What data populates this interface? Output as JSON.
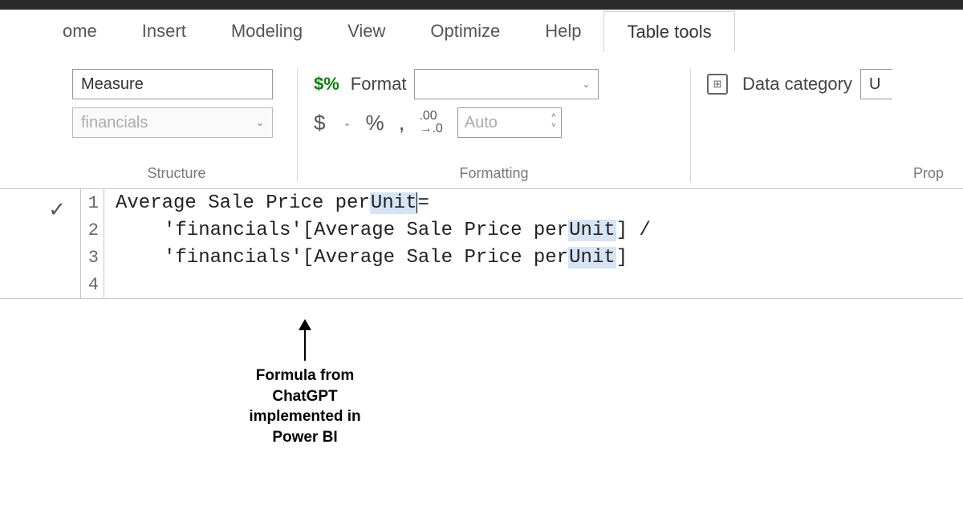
{
  "tabs": {
    "home": "ome",
    "insert": "Insert",
    "modeling": "Modeling",
    "view": "View",
    "optimize": "Optimize",
    "help": "Help",
    "table_tools": "Table tools"
  },
  "structure": {
    "name_value": "Measure",
    "table_value": "financials",
    "group_label": "Structure"
  },
  "formatting": {
    "format_label": "Format",
    "format_value": "",
    "decimals_placeholder": "Auto",
    "group_label": "Formatting"
  },
  "properties": {
    "category_label": "Data category",
    "category_value": "U",
    "group_label": "Prop"
  },
  "formula": {
    "lines": [
      {
        "n": "1",
        "prefix": "Average Sale Price per ",
        "hl": "Unit",
        "suffix": " ="
      },
      {
        "n": "2",
        "prefix": "'financials'[Average Sale Price per ",
        "hl": "Unit",
        "suffix": "] /"
      },
      {
        "n": "3",
        "prefix": "'financials'[Average Sale Price per ",
        "hl": "Unit",
        "suffix": "]"
      },
      {
        "n": "4",
        "prefix": "",
        "hl": "",
        "suffix": ""
      }
    ]
  },
  "annotation": {
    "l1": "Formula from",
    "l2": "ChatGPT",
    "l3": "implemented in",
    "l4": "Power BI"
  }
}
